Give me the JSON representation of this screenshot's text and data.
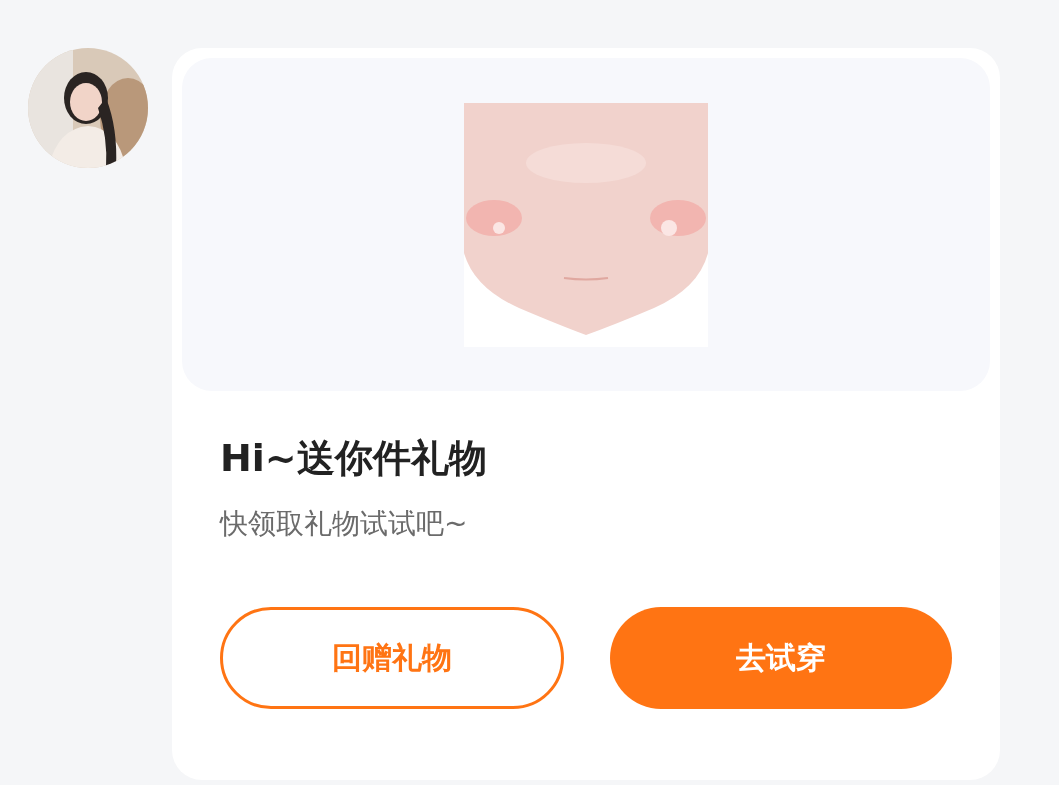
{
  "card": {
    "title": "Hi~送你件礼物",
    "subtitle": "快领取礼物试试吧~",
    "buttons": [
      {
        "label": "回赠礼物",
        "kind": "outline"
      },
      {
        "label": "去试穿",
        "kind": "filled"
      }
    ]
  }
}
